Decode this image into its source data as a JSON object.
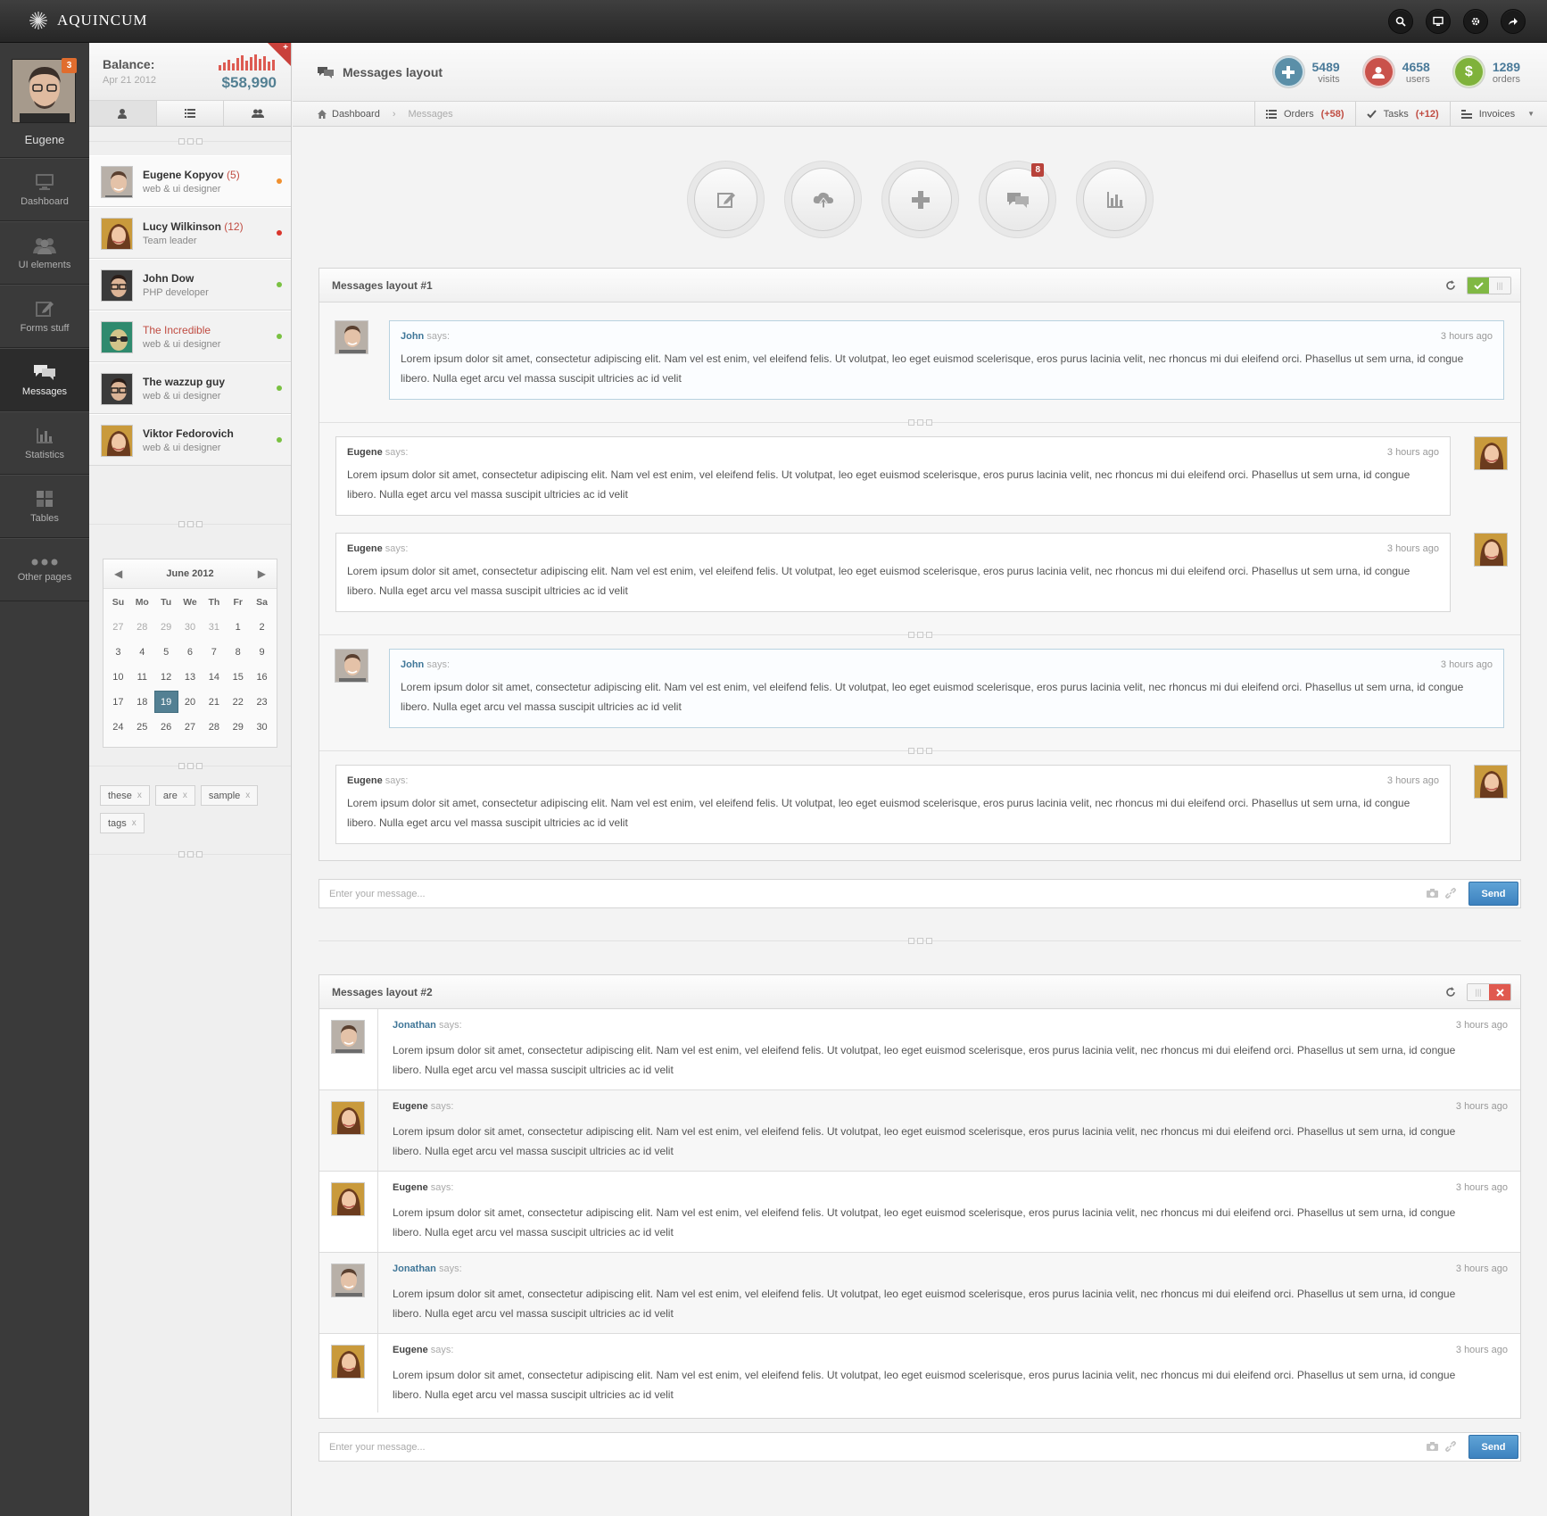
{
  "app": {
    "name": "AQUINCUM"
  },
  "topbar": {
    "icons": [
      "search-icon",
      "monitor-icon",
      "gear-icon",
      "share-icon"
    ]
  },
  "profile": {
    "name": "Eugene",
    "badge": "3"
  },
  "nav": {
    "items": [
      {
        "label": "Dashboard",
        "icon": "monitor-icon"
      },
      {
        "label": "UI elements",
        "icon": "users-icon"
      },
      {
        "label": "Forms stuff",
        "icon": "edit-icon"
      },
      {
        "label": "Messages",
        "icon": "chat-icon",
        "active": true
      },
      {
        "label": "Statistics",
        "icon": "bar-chart-icon"
      },
      {
        "label": "Tables",
        "icon": "grid-icon"
      },
      {
        "label": "Other pages",
        "icon": "dots-icon"
      }
    ]
  },
  "balance": {
    "title": "Balance:",
    "date": "Apr 21 2012",
    "amount": "$58,990",
    "sparkline": [
      6,
      9,
      12,
      8,
      14,
      17,
      11,
      15,
      18,
      13,
      16,
      10,
      12
    ]
  },
  "contacts": [
    {
      "name": "Eugene Kopyov",
      "count": "(5)",
      "role": "web & ui designer",
      "status_color": "#f0902f"
    },
    {
      "name": "Lucy Wilkinson",
      "count": "(12)",
      "role": "Team leader",
      "status_color": "#d9352c"
    },
    {
      "name": "John Dow",
      "count": "",
      "role": "PHP developer",
      "status_color": "#7ac142"
    },
    {
      "name": "The Incredible",
      "count": "",
      "role": "web & ui designer",
      "status_color": "#7ac142"
    },
    {
      "name": "The wazzup guy",
      "count": "",
      "role": "web & ui designer",
      "status_color": "#7ac142"
    },
    {
      "name": "Viktor Fedorovich",
      "count": "",
      "role": "web & ui designer",
      "status_color": "#7ac142"
    }
  ],
  "calendar": {
    "title": "June 2012",
    "dow": [
      "Su",
      "Mo",
      "Tu",
      "We",
      "Th",
      "Fr",
      "Sa"
    ],
    "days": [
      "27",
      "28",
      "29",
      "30",
      "31",
      "1",
      "2",
      "3",
      "4",
      "5",
      "6",
      "7",
      "8",
      "9",
      "10",
      "11",
      "12",
      "13",
      "14",
      "15",
      "16",
      "17",
      "18",
      "19",
      "20",
      "21",
      "22",
      "23",
      "24",
      "25",
      "26",
      "27",
      "28",
      "29",
      "30"
    ],
    "muted_count": 5,
    "today": "19"
  },
  "tags": [
    "these",
    "are",
    "sample",
    "tags"
  ],
  "page": {
    "title": "Messages layout"
  },
  "stats": [
    {
      "value": "5489",
      "label": "visits",
      "color": "#5b8fa8",
      "icon": "plus-icon"
    },
    {
      "value": "4658",
      "label": "users",
      "color": "#c9524b",
      "icon": "user-icon"
    },
    {
      "value": "1289",
      "label": "orders",
      "color": "#7fb23b",
      "icon": "dollar-icon"
    }
  ],
  "breadcrumb": {
    "home": "Dashboard",
    "current": "Messages"
  },
  "quick": {
    "orders": {
      "label": "Orders",
      "count": "(+58)"
    },
    "tasks": {
      "label": "Tasks",
      "count": "(+12)"
    },
    "invoices": {
      "label": "Invoices"
    }
  },
  "action_buttons": {
    "icons": [
      "edit-icon",
      "cloud-upload-icon",
      "plus-icon",
      "chat-icon",
      "bar-chart-icon"
    ],
    "chat_badge": "8"
  },
  "layout1": {
    "title": "Messages layout #1",
    "messages": [
      {
        "author": "John",
        "says": "says:",
        "time": "3 hours ago",
        "text": "Lorem ipsum dolor sit amet, consectetur adipiscing elit. Nam vel est enim, vel eleifend felis. Ut volutpat, leo eget euismod scelerisque, eros purus lacinia velit, nec rhoncus mi dui eleifend orci. Phasellus ut sem urna, id congue libero. Nulla eget arcu vel massa suscipit ultricies ac id velit"
      },
      {
        "author": "Eugene",
        "says": "says:",
        "time": "3 hours ago",
        "text": "Lorem ipsum dolor sit amet, consectetur adipiscing elit. Nam vel est enim, vel eleifend felis. Ut volutpat, leo eget euismod scelerisque, eros purus lacinia velit, nec rhoncus mi dui eleifend orci. Phasellus ut sem urna, id congue libero. Nulla eget arcu vel massa suscipit ultricies ac id velit"
      },
      {
        "author": "Eugene",
        "says": "says:",
        "time": "3 hours ago",
        "text": "Lorem ipsum dolor sit amet, consectetur adipiscing elit. Nam vel est enim, vel eleifend felis. Ut volutpat, leo eget euismod scelerisque, eros purus lacinia velit, nec rhoncus mi dui eleifend orci. Phasellus ut sem urna, id congue libero. Nulla eget arcu vel massa suscipit ultricies ac id velit"
      },
      {
        "author": "John",
        "says": "says:",
        "time": "3 hours ago",
        "text": "Lorem ipsum dolor sit amet, consectetur adipiscing elit. Nam vel est enim, vel eleifend felis. Ut volutpat, leo eget euismod scelerisque, eros purus lacinia velit, nec rhoncus mi dui eleifend orci. Phasellus ut sem urna, id congue libero. Nulla eget arcu vel massa suscipit ultricies ac id velit"
      },
      {
        "author": "Eugene",
        "says": "says:",
        "time": "3 hours ago",
        "text": "Lorem ipsum dolor sit amet, consectetur adipiscing elit. Nam vel est enim, vel eleifend felis. Ut volutpat, leo eget euismod scelerisque, eros purus lacinia velit, nec rhoncus mi dui eleifend orci. Phasellus ut sem urna, id congue libero. Nulla eget arcu vel massa suscipit ultricies ac id velit"
      }
    ]
  },
  "layout2": {
    "title": "Messages layout #2",
    "messages": [
      {
        "author": "Jonathan",
        "says": "says:",
        "time": "3 hours ago",
        "text": "Lorem ipsum dolor sit amet, consectetur adipiscing elit. Nam vel est enim, vel eleifend felis. Ut volutpat, leo eget euismod scelerisque, eros purus lacinia velit, nec rhoncus mi dui eleifend orci. Phasellus ut sem urna, id congue libero. Nulla eget arcu vel massa suscipit ultricies ac id velit"
      },
      {
        "author": "Eugene",
        "says": "says:",
        "time": "3 hours ago",
        "text": "Lorem ipsum dolor sit amet, consectetur adipiscing elit. Nam vel est enim, vel eleifend felis. Ut volutpat, leo eget euismod scelerisque, eros purus lacinia velit, nec rhoncus mi dui eleifend orci. Phasellus ut sem urna, id congue libero. Nulla eget arcu vel massa suscipit ultricies ac id velit"
      },
      {
        "author": "Eugene",
        "says": "says:",
        "time": "3 hours ago",
        "text": "Lorem ipsum dolor sit amet, consectetur adipiscing elit. Nam vel est enim, vel eleifend felis. Ut volutpat, leo eget euismod scelerisque, eros purus lacinia velit, nec rhoncus mi dui eleifend orci. Phasellus ut sem urna, id congue libero. Nulla eget arcu vel massa suscipit ultricies ac id velit"
      },
      {
        "author": "Jonathan",
        "says": "says:",
        "time": "3 hours ago",
        "text": "Lorem ipsum dolor sit amet, consectetur adipiscing elit. Nam vel est enim, vel eleifend felis. Ut volutpat, leo eget euismod scelerisque, eros purus lacinia velit, nec rhoncus mi dui eleifend orci. Phasellus ut sem urna, id congue libero. Nulla eget arcu vel massa suscipit ultricies ac id velit"
      },
      {
        "author": "Eugene",
        "says": "says:",
        "time": "3 hours ago",
        "text": "Lorem ipsum dolor sit amet, consectetur adipiscing elit. Nam vel est enim, vel eleifend felis. Ut volutpat, leo eget euismod scelerisque, eros purus lacinia velit, nec rhoncus mi dui eleifend orci. Phasellus ut sem urna, id congue libero. Nulla eget arcu vel massa suscipit ultricies ac id velit"
      }
    ]
  },
  "composer": {
    "placeholder": "Enter your message...",
    "send_label": "Send"
  }
}
